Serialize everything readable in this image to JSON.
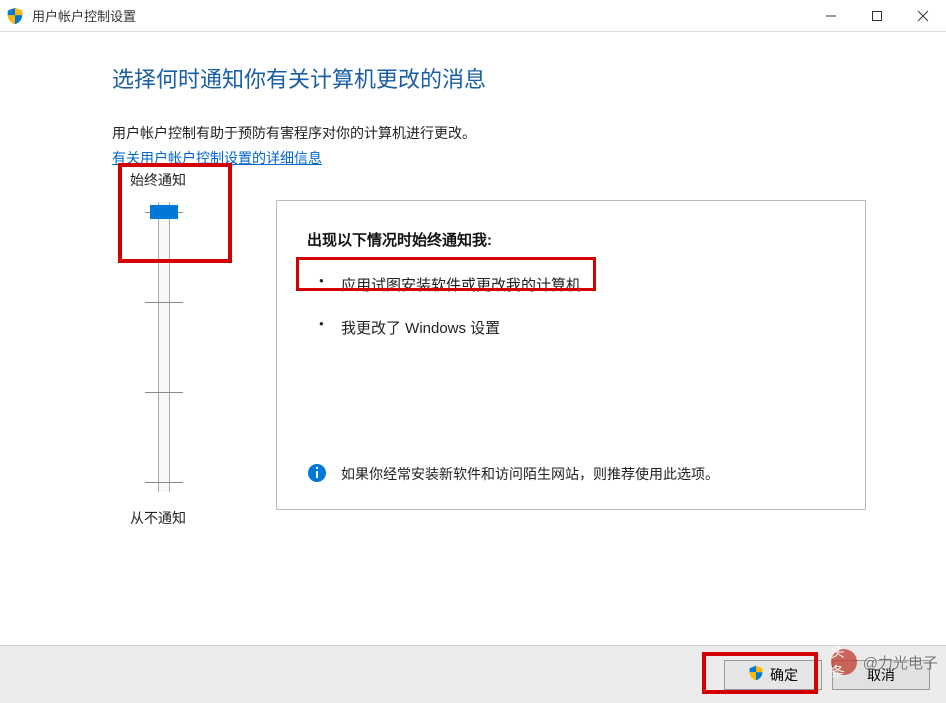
{
  "window": {
    "title": "用户帐户控制设置"
  },
  "page": {
    "heading": "选择何时通知你有关计算机更改的消息",
    "description": "用户帐户控制有助于预防有害程序对你的计算机进行更改。",
    "detail_link": "有关用户帐户控制设置的详细信息"
  },
  "slider": {
    "top_label": "始终通知",
    "bottom_label": "从不通知",
    "position": 0,
    "levels": 4
  },
  "info": {
    "heading": "出现以下情况时始终通知我:",
    "bullets": [
      "应用试图安装软件或更改我的计算机",
      "我更改了 Windows 设置"
    ],
    "recommendation": "如果你经常安装新软件和访问陌生网站，则推荐使用此选项。"
  },
  "buttons": {
    "ok": "确定",
    "cancel": "取消"
  },
  "watermark": {
    "prefix": "头条",
    "text": "@力光电子"
  }
}
